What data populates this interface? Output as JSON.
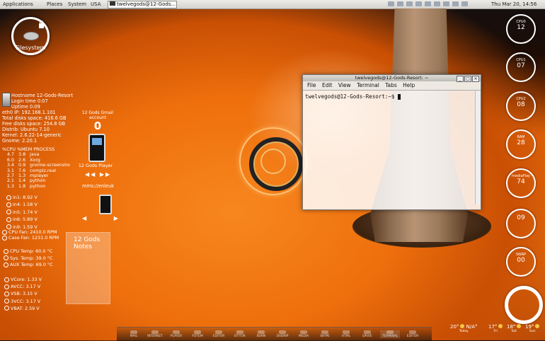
{
  "topbar": {
    "menus": [
      "Applications",
      "Places",
      "System",
      "USA"
    ],
    "task": "twelvegods@12-Gods...",
    "clock": "Thu Mar 20, 14:56"
  },
  "filesystem": {
    "label": "Filesystem"
  },
  "sysinfo": [
    "Hostname  12-Gods-Resort",
    "Login time 0:07",
    "Uptime 0:09",
    "eth0 IP: 192.168.1.101",
    "Total disks space: 416.6 GB",
    "Free disks space: 254.8 GB",
    "Distrib: Ubuntu 7.10",
    "Kernel: 2.6.22-14-generic",
    "Gnome: 2.20.1"
  ],
  "processes": {
    "header": "%CPU %MEM PROCESS",
    "rows": [
      [
        "4.7",
        "3.8",
        "java"
      ],
      [
        "6.0",
        "2.6",
        "Xorg"
      ],
      [
        "3.4",
        "0.9",
        "gnome-screensho"
      ],
      [
        "3.1",
        "7.6",
        "compiz.real"
      ],
      [
        "2.7",
        "1.3",
        "mplayer"
      ],
      [
        "2.1",
        "1.4",
        "python"
      ],
      [
        "1.3",
        "1.8",
        "python"
      ]
    ]
  },
  "voltages": [
    "in1: 8.92 V",
    "in4: 1.58 V",
    "in5: 1.74 V",
    "in6: 5.89 V",
    "in9: 1.59 V"
  ],
  "fans": [
    "CPU Fan: 2410.0 RPM",
    "Case Fan: 1231.0 RPM"
  ],
  "temps": [
    "CPU Temp: 60.0 °C",
    "Sys. Temp:  39.0 °C",
    "AUX Temp: 69.0 °C"
  ],
  "voltages2": [
    "VCore: 1.33 V",
    "AVCC: 3.17 V",
    "VSB: 3.15 V",
    "3VCC: 3.17 V",
    "VBAT: 2.59 V"
  ],
  "gmail": {
    "title": "12 Gods Gmail account",
    "count": "0"
  },
  "player": {
    "label": "12 Gods Player",
    "controls": "◀◀ ▶▶",
    "mms": "mms://enleuk",
    "controls2": "◀ ▶"
  },
  "notes": {
    "title": "12 Gods Notes"
  },
  "terminal": {
    "title": "twelvegods@12-Gods-Resort: ~",
    "menu": [
      "File",
      "Edit",
      "View",
      "Terminal",
      "Tabs",
      "Help"
    ],
    "prompt": "twelvegods@12-Gods-Resort:~$ "
  },
  "rings": [
    {
      "label": "CPU0",
      "value": "12"
    },
    {
      "label": "CPU1",
      "value": "07"
    },
    {
      "label": "CPU2",
      "value": "08"
    },
    {
      "label": "RAM",
      "value": "28"
    },
    {
      "label": "mediaPlay",
      "value": "74"
    },
    {
      "label": "",
      "value": "09"
    },
    {
      "label": "SWAP",
      "value": "00"
    }
  ],
  "dock": [
    "MAIL",
    "INTERNET",
    "PLAYER",
    "FOTEM",
    "EDITOR",
    "BT-TOR",
    "BURN",
    "DVDRIP",
    "MEDIA",
    "SKYPE",
    "HTML",
    "DRIVE",
    "TERMINAL",
    "EDITOR"
  ],
  "weather": [
    {
      "temp": "20°",
      "text": "N/A°",
      "day": "Today"
    },
    {
      "temp": "17°",
      "text": "",
      "day": "Fri"
    },
    {
      "temp": "18°",
      "text": "",
      "day": "Sat"
    },
    {
      "temp": "19°",
      "text": "",
      "day": "Sun"
    }
  ],
  "colors": {
    "accent": "#f07b14",
    "panel": "#d4d2cc"
  }
}
